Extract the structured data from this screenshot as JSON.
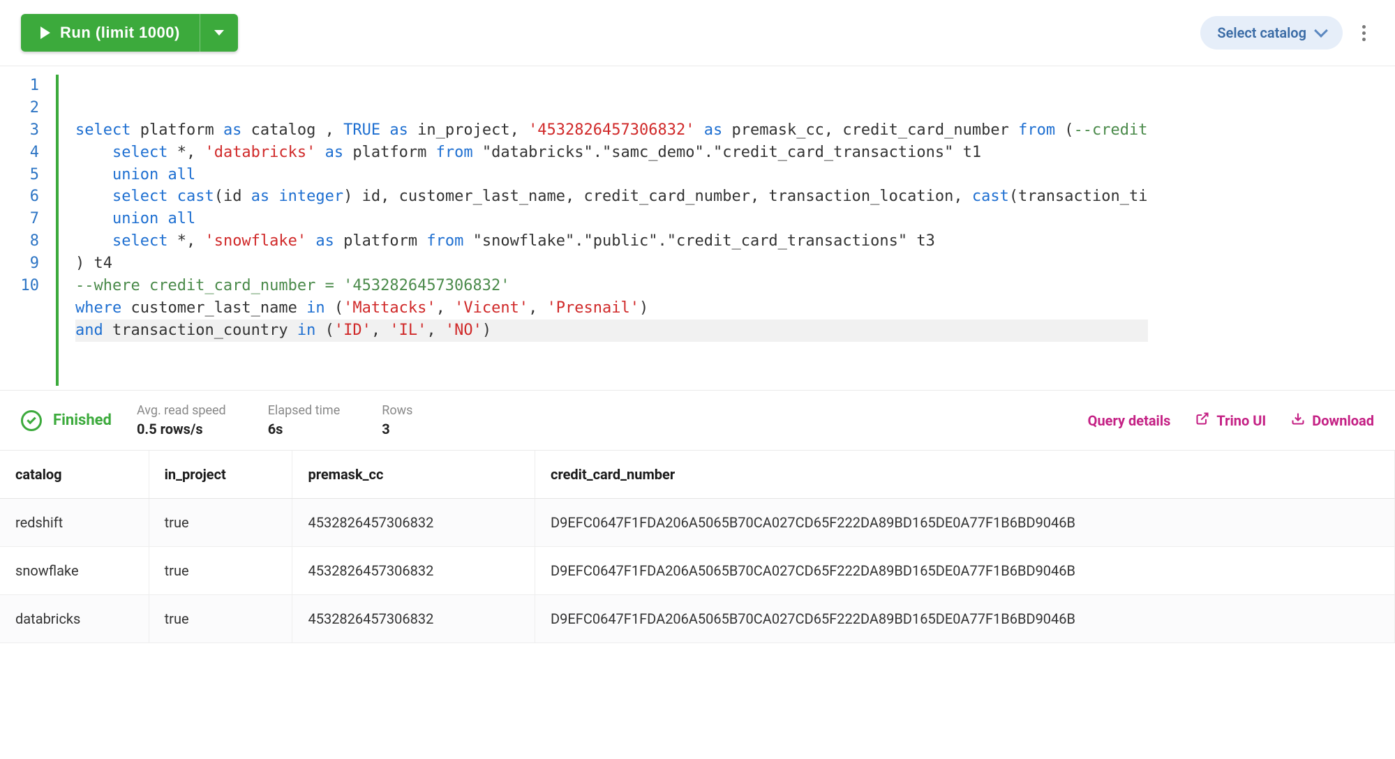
{
  "toolbar": {
    "run_label": "Run (limit 1000)",
    "catalog_label": "Select catalog"
  },
  "editor": {
    "lines": [
      {
        "num": 1,
        "tokens": [
          {
            "t": "kw",
            "v": "select"
          },
          {
            "t": "plain",
            "v": " platform "
          },
          {
            "t": "kw",
            "v": "as"
          },
          {
            "t": "plain",
            "v": " catalog , "
          },
          {
            "t": "lit",
            "v": "TRUE"
          },
          {
            "t": "plain",
            "v": " "
          },
          {
            "t": "kw",
            "v": "as"
          },
          {
            "t": "plain",
            "v": " in_project, "
          },
          {
            "t": "str",
            "v": "'4532826457306832'"
          },
          {
            "t": "plain",
            "v": " "
          },
          {
            "t": "kw",
            "v": "as"
          },
          {
            "t": "plain",
            "v": " premask_cc, credit_card_number "
          },
          {
            "t": "kw",
            "v": "from"
          },
          {
            "t": "plain",
            "v": " ("
          },
          {
            "t": "comment",
            "v": "--credit"
          }
        ]
      },
      {
        "num": 2,
        "tokens": [
          {
            "t": "plain",
            "v": "    "
          },
          {
            "t": "kw",
            "v": "select"
          },
          {
            "t": "plain",
            "v": " *, "
          },
          {
            "t": "str",
            "v": "'databricks'"
          },
          {
            "t": "plain",
            "v": " "
          },
          {
            "t": "kw",
            "v": "as"
          },
          {
            "t": "plain",
            "v": " platform "
          },
          {
            "t": "kw",
            "v": "from"
          },
          {
            "t": "plain",
            "v": " \"databricks\".\"samc_demo\".\"credit_card_transactions\" t1"
          }
        ]
      },
      {
        "num": 3,
        "tokens": [
          {
            "t": "plain",
            "v": "    "
          },
          {
            "t": "kw",
            "v": "union all"
          }
        ]
      },
      {
        "num": 4,
        "tokens": [
          {
            "t": "plain",
            "v": "    "
          },
          {
            "t": "kw",
            "v": "select"
          },
          {
            "t": "plain",
            "v": " "
          },
          {
            "t": "kw",
            "v": "cast"
          },
          {
            "t": "plain",
            "v": "(id "
          },
          {
            "t": "kw",
            "v": "as"
          },
          {
            "t": "plain",
            "v": " "
          },
          {
            "t": "kw",
            "v": "integer"
          },
          {
            "t": "plain",
            "v": ") id, customer_last_name, credit_card_number, transaction_location, "
          },
          {
            "t": "kw",
            "v": "cast"
          },
          {
            "t": "plain",
            "v": "(transaction_ti"
          }
        ]
      },
      {
        "num": 5,
        "tokens": [
          {
            "t": "plain",
            "v": "    "
          },
          {
            "t": "kw",
            "v": "union all"
          }
        ]
      },
      {
        "num": 6,
        "tokens": [
          {
            "t": "plain",
            "v": "    "
          },
          {
            "t": "kw",
            "v": "select"
          },
          {
            "t": "plain",
            "v": " *, "
          },
          {
            "t": "str",
            "v": "'snowflake'"
          },
          {
            "t": "plain",
            "v": " "
          },
          {
            "t": "kw",
            "v": "as"
          },
          {
            "t": "plain",
            "v": " platform "
          },
          {
            "t": "kw",
            "v": "from"
          },
          {
            "t": "plain",
            "v": " \"snowflake\".\"public\".\"credit_card_transactions\" t3"
          }
        ]
      },
      {
        "num": 7,
        "tokens": [
          {
            "t": "plain",
            "v": ") t4"
          }
        ]
      },
      {
        "num": 8,
        "tokens": [
          {
            "t": "comment",
            "v": "--where credit_card_number = '4532826457306832'"
          }
        ]
      },
      {
        "num": 9,
        "tokens": [
          {
            "t": "kw",
            "v": "where"
          },
          {
            "t": "plain",
            "v": " customer_last_name "
          },
          {
            "t": "kw",
            "v": "in"
          },
          {
            "t": "plain",
            "v": " ("
          },
          {
            "t": "str",
            "v": "'Mattacks'"
          },
          {
            "t": "plain",
            "v": ", "
          },
          {
            "t": "str",
            "v": "'Vicent'"
          },
          {
            "t": "plain",
            "v": ", "
          },
          {
            "t": "str",
            "v": "'Presnail'"
          },
          {
            "t": "plain",
            "v": ")"
          }
        ]
      },
      {
        "num": 10,
        "highlighted": true,
        "tokens": [
          {
            "t": "kw",
            "v": "and"
          },
          {
            "t": "plain",
            "v": " transaction_country "
          },
          {
            "t": "kw",
            "v": "in"
          },
          {
            "t": "plain",
            "v": " ("
          },
          {
            "t": "str",
            "v": "'ID'"
          },
          {
            "t": "plain",
            "v": ", "
          },
          {
            "t": "str",
            "v": "'IL'"
          },
          {
            "t": "plain",
            "v": ", "
          },
          {
            "t": "str",
            "v": "'NO'"
          },
          {
            "t": "plain",
            "v": ")"
          }
        ]
      }
    ]
  },
  "status": {
    "finished_label": "Finished",
    "metrics": [
      {
        "label": "Avg. read speed",
        "value": "0.5 rows/s"
      },
      {
        "label": "Elapsed time",
        "value": "6s"
      },
      {
        "label": "Rows",
        "value": "3"
      }
    ],
    "links": {
      "query_details": "Query details",
      "trino_ui": "Trino UI",
      "download": "Download"
    }
  },
  "results": {
    "columns": [
      "catalog",
      "in_project",
      "premask_cc",
      "credit_card_number"
    ],
    "rows": [
      [
        "redshift",
        "true",
        "4532826457306832",
        "D9EFC0647F1FDA206A5065B70CA027CD65F222DA89BD165DE0A77F1B6BD9046B"
      ],
      [
        "snowflake",
        "true",
        "4532826457306832",
        "D9EFC0647F1FDA206A5065B70CA027CD65F222DA89BD165DE0A77F1B6BD9046B"
      ],
      [
        "databricks",
        "true",
        "4532826457306832",
        "D9EFC0647F1FDA206A5065B70CA027CD65F222DA89BD165DE0A77F1B6BD9046B"
      ]
    ]
  }
}
